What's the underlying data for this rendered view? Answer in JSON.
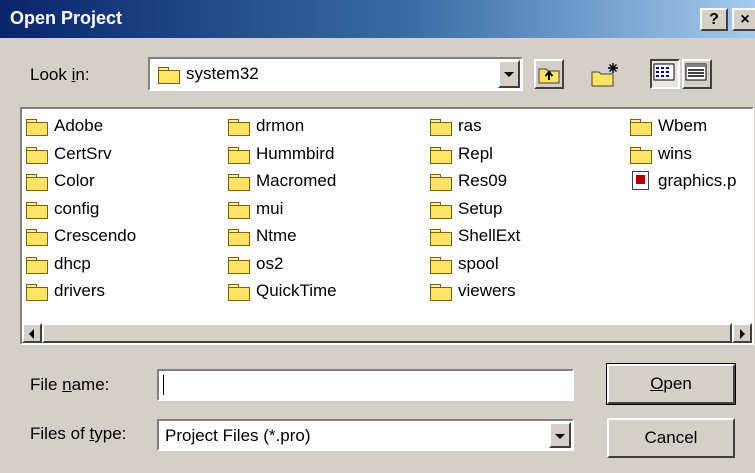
{
  "window": {
    "title": "Open Project",
    "help_label": "?",
    "close_label": "×"
  },
  "look_in": {
    "label_pre": "Look ",
    "label_mnemonic": "i",
    "label_post": "n:",
    "value": "system32",
    "icon": "folder-icon"
  },
  "toolbar": {
    "up_folder_icon": "up-one-level-icon",
    "new_folder_icon": "new-folder-icon",
    "list_view_icon": "list-view-icon",
    "details_view_icon": "details-view-icon"
  },
  "files": {
    "columns": [
      [
        {
          "name": "Adobe",
          "type": "folder"
        },
        {
          "name": "CertSrv",
          "type": "folder"
        },
        {
          "name": "Color",
          "type": "folder"
        },
        {
          "name": "config",
          "type": "folder"
        },
        {
          "name": "Crescendo",
          "type": "folder"
        },
        {
          "name": "dhcp",
          "type": "folder"
        },
        {
          "name": "drivers",
          "type": "folder"
        }
      ],
      [
        {
          "name": "drmon",
          "type": "folder"
        },
        {
          "name": "Hummbird",
          "type": "folder"
        },
        {
          "name": "Macromed",
          "type": "folder"
        },
        {
          "name": "mui",
          "type": "folder"
        },
        {
          "name": "Ntme",
          "type": "folder"
        },
        {
          "name": "os2",
          "type": "folder"
        },
        {
          "name": "QuickTime",
          "type": "folder"
        }
      ],
      [
        {
          "name": "ras",
          "type": "folder"
        },
        {
          "name": "Repl",
          "type": "folder"
        },
        {
          "name": "Res09",
          "type": "folder"
        },
        {
          "name": "Setup",
          "type": "folder"
        },
        {
          "name": "ShellExt",
          "type": "folder"
        },
        {
          "name": "spool",
          "type": "folder"
        },
        {
          "name": "viewers",
          "type": "folder"
        }
      ],
      [
        {
          "name": "Wbem",
          "type": "folder"
        },
        {
          "name": "wins",
          "type": "folder"
        },
        {
          "name": "graphics.p",
          "type": "file"
        }
      ]
    ]
  },
  "file_name": {
    "label_pre": "File ",
    "label_mnemonic": "n",
    "label_post": "ame:",
    "value": ""
  },
  "file_type": {
    "label_pre": "Files of ",
    "label_mnemonic": "t",
    "label_post": "ype:",
    "value": "Project Files (*.pro)"
  },
  "buttons": {
    "open_mnemonic": "O",
    "open_rest": "pen",
    "cancel": "Cancel"
  },
  "colors": {
    "title_gradient_start": "#0a246a",
    "title_gradient_end": "#a6caf0",
    "dialog_face": "#d4d0c8",
    "folder_yellow": "#ffe466"
  }
}
